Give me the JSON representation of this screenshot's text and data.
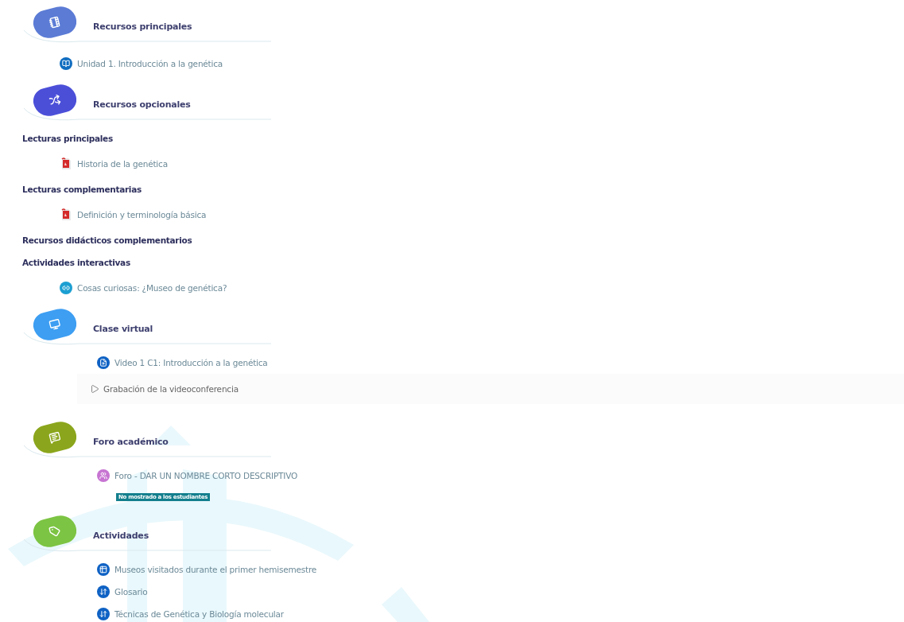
{
  "sections": [
    {
      "title": "Recursos principales",
      "color": "#5b7bd5",
      "items": [
        {
          "kind": "page",
          "label": "Unidad 1. Introducción a la genética"
        }
      ]
    },
    {
      "title": "Recursos opcionales",
      "color": "#4b4fd8",
      "items": [
        {
          "kind": "heading",
          "label": "Lecturas principales"
        },
        {
          "kind": "file",
          "label": "Historia de la genética"
        },
        {
          "kind": "heading",
          "label": "Lecturas complementarias"
        },
        {
          "kind": "file",
          "label": "Definición y terminología básica"
        },
        {
          "kind": "heading",
          "label": "Recursos didácticos complementarios"
        },
        {
          "kind": "heading",
          "label": "Actividades interactivas"
        },
        {
          "kind": "url",
          "label": "Cosas curiosas: ¿Museo de genética?"
        }
      ]
    },
    {
      "title": "Clase virtual",
      "color": "#3d9ef2",
      "items": [
        {
          "kind": "h5p",
          "label": "Video 1 C1: Introducción a la genética"
        },
        {
          "kind": "recording",
          "label": "Grabación de la videoconferencia"
        }
      ]
    },
    {
      "title": "Foro académico",
      "color": "#8ba61c",
      "items": [
        {
          "kind": "forum",
          "label": "Foro - DAR UN NOMBRE CORTO DESCRIPTIVO",
          "badge": "No mostrado a los estudiantes"
        }
      ]
    },
    {
      "title": "Actividades",
      "color": "#7cc443",
      "items": [
        {
          "kind": "database",
          "label": "Museos visitados durante el primer hemisemestre"
        },
        {
          "kind": "glossary",
          "label": "Glosario"
        },
        {
          "kind": "glossary",
          "label": "Técnicas de Genética y Biología molecular"
        }
      ]
    }
  ]
}
